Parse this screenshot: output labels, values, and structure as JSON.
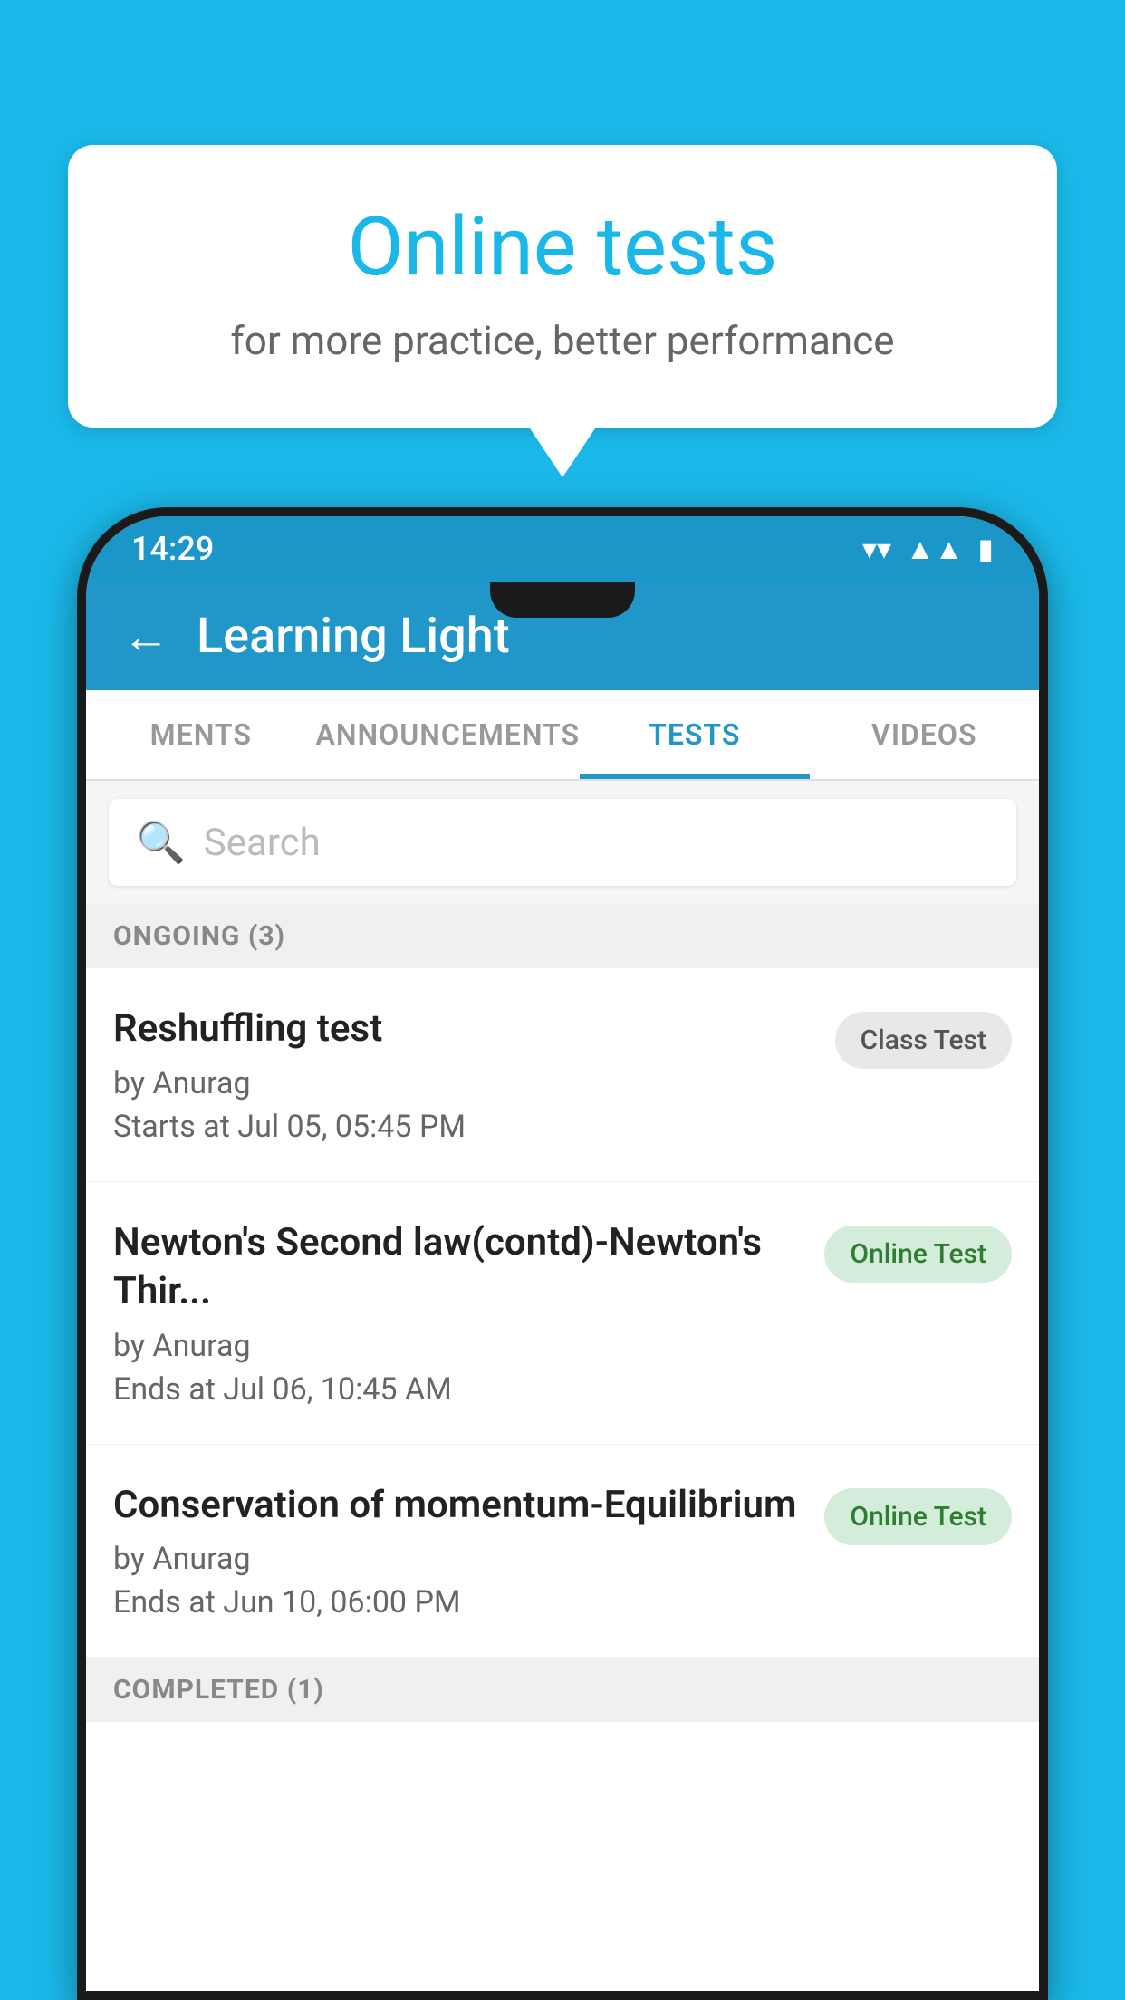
{
  "background": {
    "color": "#1ab8e8"
  },
  "speech_bubble": {
    "title": "Online tests",
    "subtitle": "for more practice, better performance"
  },
  "status_bar": {
    "time": "14:29",
    "wifi_icon": "▼",
    "signal_icon": "▲",
    "battery_icon": "▮"
  },
  "app_bar": {
    "back_label": "←",
    "title": "Learning Light"
  },
  "tabs": [
    {
      "label": "MENTS",
      "active": false
    },
    {
      "label": "ANNOUNCEMENTS",
      "active": false
    },
    {
      "label": "TESTS",
      "active": true
    },
    {
      "label": "VIDEOS",
      "active": false
    }
  ],
  "search": {
    "placeholder": "Search"
  },
  "sections": [
    {
      "header": "ONGOING (3)",
      "tests": [
        {
          "name": "Reshuffling test",
          "by": "by Anurag",
          "date": "Starts at  Jul 05, 05:45 PM",
          "badge": "Class Test",
          "badge_type": "class"
        },
        {
          "name": "Newton's Second law(contd)-Newton's Thir...",
          "by": "by Anurag",
          "date": "Ends at  Jul 06, 10:45 AM",
          "badge": "Online Test",
          "badge_type": "online"
        },
        {
          "name": "Conservation of momentum-Equilibrium",
          "by": "by Anurag",
          "date": "Ends at  Jun 10, 06:00 PM",
          "badge": "Online Test",
          "badge_type": "online"
        }
      ]
    }
  ],
  "completed_header": "COMPLETED (1)"
}
